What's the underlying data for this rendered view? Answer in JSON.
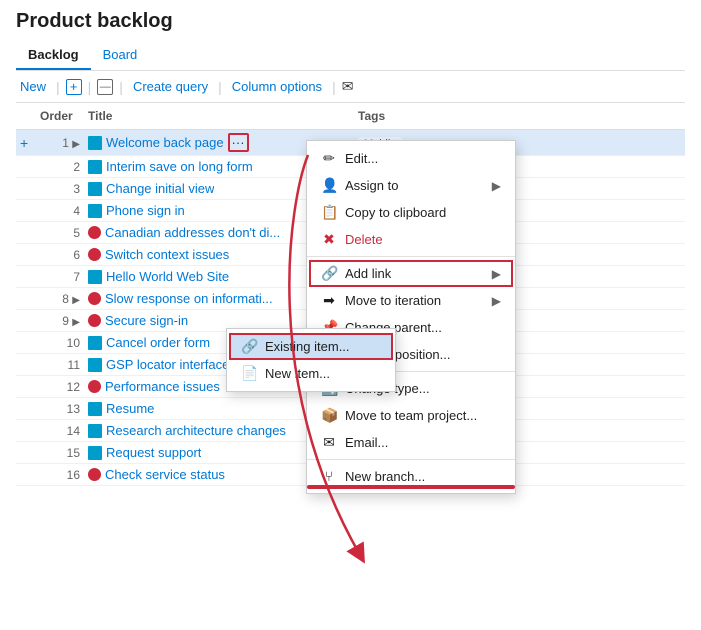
{
  "page": {
    "title": "Product backlog",
    "tabs": [
      {
        "label": "Backlog",
        "active": true
      },
      {
        "label": "Board",
        "active": false
      }
    ],
    "toolbar": {
      "new_label": "New",
      "create_query_label": "Create query",
      "column_options_label": "Column options"
    },
    "grid": {
      "columns": [
        "",
        "Order",
        "Title",
        "Tags"
      ],
      "rows": [
        {
          "num": 1,
          "expand": true,
          "type": "blue",
          "title": "Welcome back page",
          "tags": "Mobile",
          "ellipsis": true,
          "highlighted": true
        },
        {
          "num": 2,
          "expand": false,
          "type": "blue",
          "title": "Interim save on long form",
          "tags": ""
        },
        {
          "num": 3,
          "expand": false,
          "type": "blue",
          "title": "Change initial view",
          "tags": ""
        },
        {
          "num": 4,
          "expand": false,
          "type": "blue",
          "title": "Phone sign in",
          "tags": ""
        },
        {
          "num": 5,
          "expand": false,
          "type": "red",
          "title": "Canadian addresses don't di...",
          "tags": ""
        },
        {
          "num": 6,
          "expand": false,
          "type": "red",
          "title": "Switch context issues",
          "tags": ""
        },
        {
          "num": 7,
          "expand": false,
          "type": "blue",
          "title": "Hello World Web Site",
          "tags": ""
        },
        {
          "num": 8,
          "expand": true,
          "type": "red",
          "title": "Slow response on informati...",
          "tags": ""
        },
        {
          "num": 9,
          "expand": true,
          "type": "red",
          "title": "Secure sign-in",
          "tags": ""
        },
        {
          "num": 10,
          "expand": false,
          "type": "blue",
          "title": "Cancel order form",
          "tags": ""
        },
        {
          "num": 11,
          "expand": false,
          "type": "blue",
          "title": "GSP locator interface",
          "tags": ""
        },
        {
          "num": 12,
          "expand": false,
          "type": "red",
          "title": "Performance issues",
          "tags": ""
        },
        {
          "num": 13,
          "expand": false,
          "type": "blue",
          "title": "Resume",
          "tags": ""
        },
        {
          "num": 14,
          "expand": false,
          "type": "blue",
          "title": "Research architecture changes",
          "tags": ""
        },
        {
          "num": 15,
          "expand": false,
          "type": "blue",
          "title": "Request support",
          "tags": ""
        },
        {
          "num": 16,
          "expand": false,
          "type": "red",
          "title": "Check service status",
          "tags": ""
        }
      ]
    }
  },
  "context_menu": {
    "items": [
      {
        "icon": "✏️",
        "label": "Edit...",
        "has_sub": false
      },
      {
        "icon": "👤",
        "label": "Assign to",
        "has_sub": true
      },
      {
        "icon": "📋",
        "label": "Copy to clipboard",
        "has_sub": false
      },
      {
        "icon": "✖",
        "label": "Delete",
        "has_sub": false,
        "red": true
      },
      {
        "icon": "🔗",
        "label": "Add link",
        "has_sub": true,
        "highlighted": true
      },
      {
        "icon": "➡",
        "label": "Move to iteration",
        "has_sub": true
      },
      {
        "icon": "📌",
        "label": "Change parent...",
        "has_sub": false
      },
      {
        "icon": "📍",
        "label": "Move to position...",
        "has_sub": false
      },
      {
        "icon": "🔄",
        "label": "Change type...",
        "has_sub": false
      },
      {
        "icon": "📦",
        "label": "Move to team project...",
        "has_sub": false
      },
      {
        "icon": "✉",
        "label": "Email...",
        "has_sub": false
      },
      {
        "icon": "🌿",
        "label": "New branch...",
        "has_sub": false
      }
    ],
    "sub_items": [
      {
        "icon": "🔗",
        "label": "Existing item...",
        "highlighted": true
      },
      {
        "icon": "📄",
        "label": "New item..."
      }
    ]
  }
}
